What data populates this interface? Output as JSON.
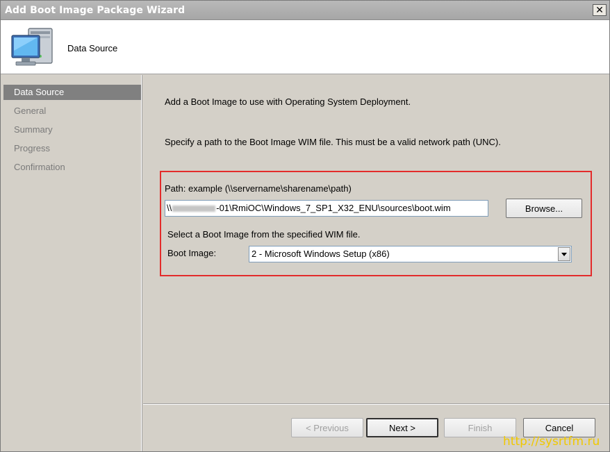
{
  "window": {
    "title": "Add Boot Image Package Wizard"
  },
  "header": {
    "title": "Data Source",
    "icon": "computer-icon"
  },
  "sidebar": {
    "items": [
      {
        "label": "Data Source",
        "active": true
      },
      {
        "label": "General",
        "active": false
      },
      {
        "label": "Summary",
        "active": false
      },
      {
        "label": "Progress",
        "active": false
      },
      {
        "label": "Confirmation",
        "active": false
      }
    ]
  },
  "content": {
    "intro": "Add a Boot Image to use with Operating System Deployment.",
    "instruction": "Specify a path to the Boot Image WIM file. This must be a valid network path (UNC).",
    "path_label": "Path: example (\\\\servername\\sharename\\path)",
    "path_value_prefix": "\\\\",
    "path_value_suffix": "-01\\RmiOC\\Windows_7_SP1_X32_ENU\\sources\\boot.wim",
    "browse_label": "Browse...",
    "select_hint": "Select a Boot Image from the specified WIM file.",
    "boot_image_label": "Boot Image:",
    "boot_image_selected": "2 - Microsoft Windows Setup (x86)"
  },
  "footer": {
    "previous": "< Previous",
    "next": "Next >",
    "finish": "Finish",
    "cancel": "Cancel"
  },
  "watermark": "http://sysrtfm.ru",
  "colors": {
    "highlight_box": "#e32b2b",
    "active_nav": "#808080",
    "watermark": "#f0c800"
  }
}
